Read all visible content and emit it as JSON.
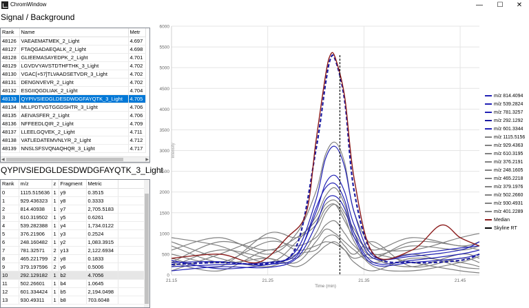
{
  "window": {
    "title": "ChromWindow",
    "minimize": "—",
    "maximize": "☐",
    "close": "✕"
  },
  "top_panel": {
    "title": "Signal / Background",
    "columns": [
      "Rank",
      "Name",
      "Metr"
    ],
    "rows": [
      [
        "48126",
        "VAEAEMATMEK_2_Light",
        "4.697"
      ],
      [
        "48127",
        "FTAQGADAEQALK_2_Light",
        "4.698"
      ],
      [
        "48128",
        "GLIEEMASAYEDPK_2_Light",
        "4.701"
      ],
      [
        "48129",
        "LGVDVYAVSTDTHFTHK_3_Light",
        "4.702"
      ],
      [
        "48130",
        "VGAC[+57]TLVAADSETVDR_3_Light",
        "4.702"
      ],
      [
        "48131",
        "DENGNVEVR_2_Light",
        "4.702"
      ],
      [
        "48132",
        "ESGIIQGDLIAK_2_Light",
        "4.704"
      ],
      [
        "48133",
        "QYPIVSIEDGLDESDWDGFAYQTK_3_Light",
        "4.705"
      ],
      [
        "48134",
        "MLLPDTVGTGGDSHTR_3_Light",
        "4.706"
      ],
      [
        "48135",
        "AEIVASFER_2_Light",
        "4.706"
      ],
      [
        "48136",
        "NFFEEDLQIR_2_Light",
        "4.709"
      ],
      [
        "48137",
        "LLEELGQVEK_2_Light",
        "4.711"
      ],
      [
        "48138",
        "VATLEDATEMVNLYR_2_Light",
        "4.712"
      ],
      [
        "48139",
        "NNSLSFSVQNAQHQR_3_Light",
        "4.717"
      ]
    ],
    "selected_index": 7
  },
  "bottom_panel": {
    "title": "QYPIVSIEDGLDESDWDGFAYQTK_3_Light",
    "columns": [
      "Rank",
      "m/z",
      "z",
      "Fragment",
      "Metric"
    ],
    "rows": [
      [
        "0",
        "1115.515636",
        "1",
        "y9",
        "0.3515"
      ],
      [
        "1",
        "929.436323",
        "1",
        "y8",
        "0.3333"
      ],
      [
        "2",
        "814.40938",
        "1",
        "y7",
        "2,705.5183"
      ],
      [
        "3",
        "610.319502",
        "1",
        "y5",
        "0.6261"
      ],
      [
        "4",
        "539.282388",
        "1",
        "y4",
        "1,734.0122"
      ],
      [
        "5",
        "376.21906",
        "1",
        "y3",
        "0.2524"
      ],
      [
        "6",
        "248.160482",
        "1",
        "y2",
        "1,083.3915"
      ],
      [
        "7",
        "781.32571",
        "2",
        "y13",
        "2,122.6934"
      ],
      [
        "8",
        "465.221799",
        "2",
        "y8",
        "0.1833"
      ],
      [
        "9",
        "379.197596",
        "2",
        "y6",
        "0.5006"
      ],
      [
        "10",
        "292.129182",
        "1",
        "b2",
        "4.7056"
      ],
      [
        "11",
        "502.26601",
        "1",
        "b4",
        "1.0645"
      ],
      [
        "12",
        "601.334424",
        "1",
        "b5",
        "2,194.0498"
      ],
      [
        "13",
        "930.49311",
        "1",
        "b8",
        "703.6048"
      ]
    ],
    "selected_index": 10
  },
  "chart_data": {
    "type": "line",
    "xlabel": "Time (min)",
    "ylabel": "Intensity",
    "xlim": [
      21.15,
      21.47
    ],
    "ylim": [
      0,
      6000
    ],
    "x_ticks": [
      "21.15",
      "21.25",
      "21.35",
      "21.45"
    ],
    "y_ticks": [
      "0",
      "500",
      "1000",
      "1500",
      "2000",
      "2500",
      "3000",
      "3500",
      "4000",
      "4500",
      "5000",
      "5500",
      "6000"
    ],
    "grid": true,
    "legend_position": "right",
    "skyline_rt": 21.325,
    "series": [
      {
        "name": "m/z 814.4094",
        "color": "#1f1fb4",
        "dash": false,
        "x": [
          21.15,
          21.2,
          21.25,
          21.28,
          21.3,
          21.31,
          21.32,
          21.33,
          21.34,
          21.36,
          21.4,
          21.45,
          21.47
        ],
        "y": [
          300,
          320,
          250,
          600,
          1800,
          2800,
          3100,
          2600,
          1500,
          450,
          450,
          600,
          800
        ]
      },
      {
        "name": "m/z 539.2824",
        "color": "#1f1fb4",
        "dash": false,
        "x": [
          21.15,
          21.2,
          21.25,
          21.28,
          21.3,
          21.31,
          21.32,
          21.33,
          21.34,
          21.36,
          21.4,
          21.45,
          21.47
        ],
        "y": [
          200,
          250,
          300,
          500,
          1500,
          2200,
          2400,
          2000,
          1200,
          400,
          500,
          650,
          700
        ]
      },
      {
        "name": "m/z 781.3257",
        "color": "#1f1fb4",
        "dash": false,
        "x": [
          21.15,
          21.2,
          21.25,
          21.28,
          21.3,
          21.31,
          21.32,
          21.33,
          21.34,
          21.36,
          21.4,
          21.45,
          21.47
        ],
        "y": [
          350,
          150,
          250,
          450,
          1600,
          2100,
          2200,
          1800,
          1000,
          300,
          350,
          500,
          600
        ]
      },
      {
        "name": "m/z 292.1292",
        "color": "#1a1aa0",
        "dash": true,
        "x": [
          21.15,
          21.2,
          21.25,
          21.28,
          21.3,
          21.31,
          21.315,
          21.32,
          21.33,
          21.34,
          21.36,
          21.4,
          21.45,
          21.47
        ],
        "y": [
          250,
          300,
          280,
          700,
          3000,
          4600,
          5200,
          5200,
          4200,
          2000,
          500,
          300,
          350,
          500
        ]
      },
      {
        "name": "m/z 601.3344",
        "color": "#1f1fb4",
        "dash": false,
        "x": [
          21.15,
          21.2,
          21.25,
          21.28,
          21.3,
          21.31,
          21.32,
          21.33,
          21.34,
          21.36,
          21.4,
          21.45,
          21.47
        ],
        "y": [
          100,
          200,
          180,
          400,
          1200,
          1800,
          1900,
          1600,
          900,
          250,
          300,
          400,
          500
        ]
      },
      {
        "name": "m/z 1115.5156",
        "color": "#808080",
        "dash": false,
        "x": [
          21.15,
          21.2,
          21.25,
          21.28,
          21.3,
          21.31,
          21.32,
          21.33,
          21.34,
          21.36,
          21.4,
          21.45,
          21.47
        ],
        "y": [
          500,
          300,
          800,
          700,
          900,
          1200,
          1300,
          1000,
          700,
          400,
          800,
          700,
          600
        ]
      },
      {
        "name": "m/z 929.4363",
        "color": "#808080",
        "dash": false,
        "x": [
          21.15,
          21.2,
          21.25,
          21.28,
          21.3,
          21.31,
          21.32,
          21.33,
          21.34,
          21.36,
          21.4,
          21.45,
          21.47
        ],
        "y": [
          200,
          600,
          400,
          300,
          800,
          1100,
          1000,
          800,
          600,
          300,
          500,
          200,
          150
        ]
      },
      {
        "name": "m/z 610.3195",
        "color": "#808080",
        "dash": false,
        "x": [
          21.15,
          21.2,
          21.25,
          21.28,
          21.3,
          21.31,
          21.32,
          21.33,
          21.34,
          21.36,
          21.4,
          21.45,
          21.47
        ],
        "y": [
          600,
          900,
          500,
          1000,
          2000,
          2900,
          3200,
          2700,
          1500,
          700,
          600,
          900,
          1000
        ]
      },
      {
        "name": "m/z 376.2191",
        "color": "#808080",
        "dash": false,
        "x": [
          21.15,
          21.2,
          21.25,
          21.28,
          21.3,
          21.31,
          21.32,
          21.33,
          21.34,
          21.36,
          21.4,
          21.45,
          21.47
        ],
        "y": [
          800,
          400,
          200,
          500,
          600,
          900,
          950,
          700,
          500,
          800,
          200,
          400,
          300
        ]
      },
      {
        "name": "m/z 248.1605",
        "color": "#808080",
        "dash": false,
        "x": [
          21.15,
          21.2,
          21.25,
          21.28,
          21.3,
          21.31,
          21.32,
          21.33,
          21.34,
          21.36,
          21.4,
          21.45,
          21.47
        ],
        "y": [
          300,
          100,
          600,
          400,
          1000,
          1500,
          1700,
          1400,
          800,
          200,
          100,
          300,
          450
        ]
      },
      {
        "name": "m/z 465.2218",
        "color": "#808080",
        "dash": false,
        "x": [
          21.15,
          21.2,
          21.25,
          21.28,
          21.3,
          21.31,
          21.32,
          21.33,
          21.34,
          21.36,
          21.4,
          21.45,
          21.47
        ],
        "y": [
          100,
          500,
          900,
          600,
          700,
          800,
          750,
          600,
          400,
          500,
          300,
          100,
          50
        ]
      },
      {
        "name": "m/z 379.1976",
        "color": "#808080",
        "dash": false,
        "x": [
          21.15,
          21.2,
          21.25,
          21.28,
          21.3,
          21.31,
          21.32,
          21.33,
          21.34,
          21.36,
          21.4,
          21.45,
          21.47
        ],
        "y": [
          900,
          700,
          300,
          800,
          1400,
          1900,
          2100,
          1700,
          1000,
          600,
          900,
          700,
          800
        ]
      },
      {
        "name": "m/z 502.2660",
        "color": "#808080",
        "dash": false,
        "x": [
          21.15,
          21.2,
          21.25,
          21.28,
          21.3,
          21.31,
          21.32,
          21.33,
          21.34,
          21.36,
          21.4,
          21.45,
          21.47
        ],
        "y": [
          400,
          200,
          1000,
          900,
          1200,
          1600,
          1700,
          1300,
          900,
          400,
          200,
          500,
          400
        ]
      },
      {
        "name": "m/z 930.4931",
        "color": "#808080",
        "dash": false,
        "x": [
          21.15,
          21.2,
          21.25,
          21.28,
          21.3,
          21.31,
          21.32,
          21.33,
          21.34,
          21.36,
          21.4,
          21.45,
          21.47
        ],
        "y": [
          700,
          300,
          400,
          200,
          500,
          700,
          800,
          600,
          300,
          100,
          400,
          300,
          200
        ]
      },
      {
        "name": "m/z 401.2289",
        "color": "#808080",
        "dash": false,
        "x": [
          21.15,
          21.2,
          21.25,
          21.28,
          21.3,
          21.31,
          21.32,
          21.33,
          21.34,
          21.36,
          21.4,
          21.45,
          21.47
        ],
        "y": [
          300,
          800,
          600,
          900,
          1300,
          1700,
          1800,
          1500,
          1100,
          500,
          700,
          600,
          700
        ]
      },
      {
        "name": "Median",
        "color": "#8b1a1a",
        "dash": false,
        "x": [
          21.15,
          21.2,
          21.24,
          21.27,
          21.29,
          21.3,
          21.31,
          21.315,
          21.32,
          21.33,
          21.34,
          21.36,
          21.4,
          21.43,
          21.45,
          21.47
        ],
        "y": [
          400,
          500,
          300,
          900,
          1500,
          3200,
          4800,
          5300,
          5250,
          4300,
          2300,
          500,
          600,
          1200,
          900,
          700
        ]
      },
      {
        "name": "Skyline RT",
        "color": "#000000",
        "dash": true,
        "x": [],
        "y": []
      }
    ]
  }
}
